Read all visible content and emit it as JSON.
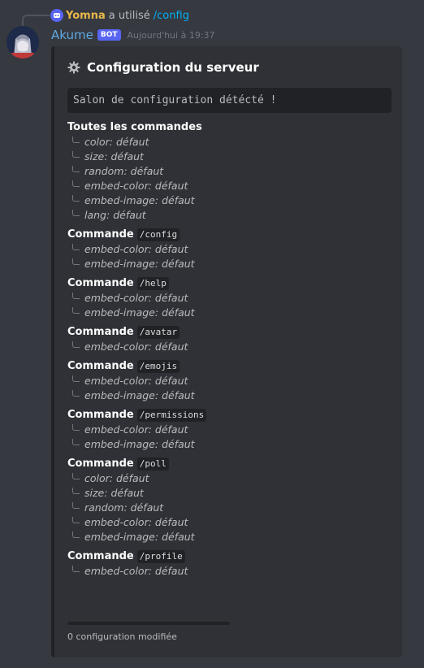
{
  "reply": {
    "username": "Yomna",
    "action": "a utilisé",
    "command": "/config"
  },
  "message": {
    "username": "Akume",
    "bot_tag": "BOT",
    "timestamp": "Aujourd'hui à 19:37"
  },
  "embed": {
    "title": "Configuration du serveur",
    "code_text": "Salon de configuration détécté !",
    "fields": [
      {
        "prefix": "Toutes les commandes",
        "command": "",
        "options": [
          {
            "key": "color",
            "value": "défaut"
          },
          {
            "key": "size",
            "value": "défaut"
          },
          {
            "key": "random",
            "value": "défaut"
          },
          {
            "key": "embed-color",
            "value": "défaut"
          },
          {
            "key": "embed-image",
            "value": "défaut"
          },
          {
            "key": "lang",
            "value": "défaut"
          }
        ]
      },
      {
        "prefix": "Commande",
        "command": "/config",
        "options": [
          {
            "key": "embed-color",
            "value": "défaut"
          },
          {
            "key": "embed-image",
            "value": "défaut"
          }
        ]
      },
      {
        "prefix": "Commande",
        "command": "/help",
        "options": [
          {
            "key": "embed-color",
            "value": "défaut"
          },
          {
            "key": "embed-image",
            "value": "défaut"
          }
        ]
      },
      {
        "prefix": "Commande",
        "command": "/avatar",
        "options": [
          {
            "key": "embed-color",
            "value": "défaut"
          }
        ]
      },
      {
        "prefix": "Commande",
        "command": "/emojis",
        "options": [
          {
            "key": "embed-color",
            "value": "défaut"
          },
          {
            "key": "embed-image",
            "value": "défaut"
          }
        ]
      },
      {
        "prefix": "Commande",
        "command": "/permissions",
        "options": [
          {
            "key": "embed-color",
            "value": "défaut"
          },
          {
            "key": "embed-image",
            "value": "défaut"
          }
        ]
      },
      {
        "prefix": "Commande",
        "command": "/poll",
        "options": [
          {
            "key": "color",
            "value": "défaut"
          },
          {
            "key": "size",
            "value": "défaut"
          },
          {
            "key": "random",
            "value": "défaut"
          },
          {
            "key": "embed-color",
            "value": "défaut"
          },
          {
            "key": "embed-image",
            "value": "défaut"
          }
        ]
      },
      {
        "prefix": "Commande",
        "command": "/profile",
        "options": [
          {
            "key": "embed-color",
            "value": "défaut"
          }
        ]
      }
    ],
    "footer": "0 configuration modifiée"
  },
  "colors": {
    "background": "#36393f",
    "embed_bg": "#2f3136",
    "username": "#5fa8e4",
    "bot_tag": "#5865f2",
    "reply_user": "#e8b84a",
    "command_link": "#00aff4"
  },
  "icons": {
    "reply_avatar": "bot-face-icon",
    "title_icon": "gear-icon"
  }
}
